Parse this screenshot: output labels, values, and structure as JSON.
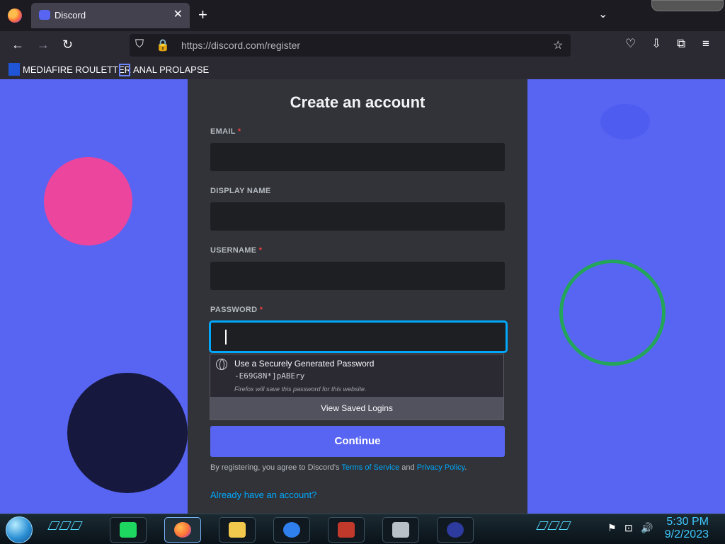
{
  "browser": {
    "tab_title": "Discord",
    "url_domain": "https://discord.com",
    "url_path": "/register",
    "bookmarks": [
      {
        "label": "MEDIAFIRE ROULETTER"
      },
      {
        "label": "ANAL PROLAPSE"
      }
    ],
    "icons": [
      "firefox-icon",
      "discord-icon",
      "back-icon",
      "forward-icon",
      "reload-icon",
      "shield-icon",
      "lock-icon",
      "star-icon",
      "pocket-icon",
      "download-icon",
      "extensions-icon",
      "menu-icon"
    ]
  },
  "form": {
    "title": "Create an account",
    "email_label": "EMAIL",
    "display_name_label": "DISPLAY NAME",
    "username_label": "USERNAME",
    "password_label": "PASSWORD",
    "required_mark": "*",
    "password_suggest": {
      "title": "Use a Securely Generated Password",
      "value": "-E69G8N*]pABEry",
      "note": "Firefox will save this password for this website.",
      "footer": "View Saved Logins"
    },
    "continue_label": "Continue",
    "terms_prefix": "By registering, you agree to Discord's ",
    "terms_link": "Terms of Service",
    "terms_and": " and ",
    "privacy_link": "Privacy Policy",
    "terms_suffix": ".",
    "already_link": "Already have an account?"
  },
  "taskbar": {
    "time": "5:30 PM",
    "date": "9/2/2023",
    "apps": [
      "notes-app",
      "firefox",
      "file-manager",
      "app-launcher",
      "media-app",
      "monitor-app",
      "x-app"
    ]
  },
  "colors": {
    "background": "#5865f2",
    "panel": "#313338",
    "input": "#1e1f22",
    "focus": "#00a8fc",
    "required": "#f23f42"
  }
}
